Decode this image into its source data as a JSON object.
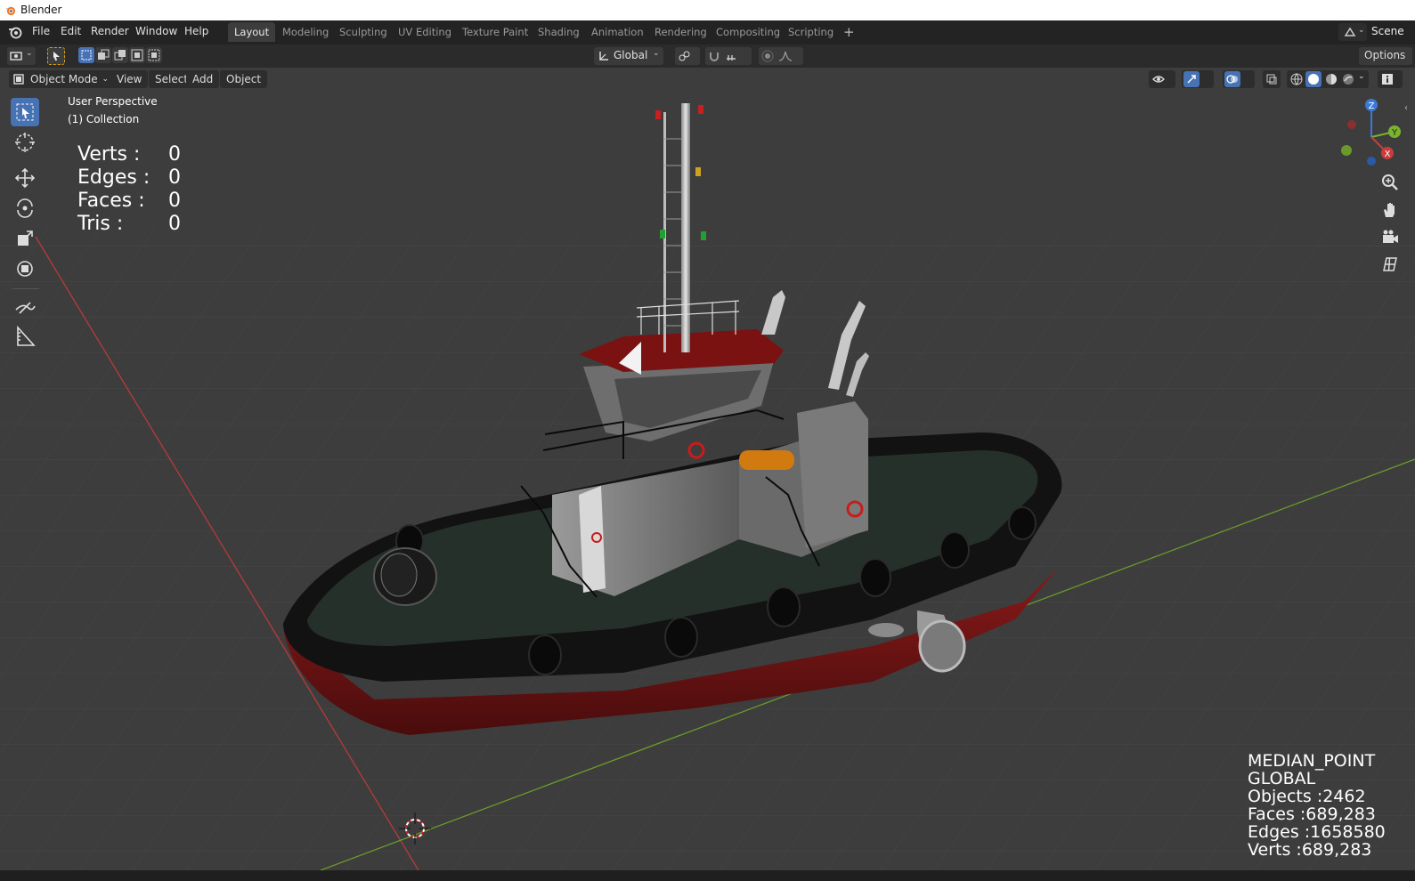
{
  "window": {
    "title": "Blender"
  },
  "menu": [
    "File",
    "Edit",
    "Render",
    "Window",
    "Help"
  ],
  "workspaces": [
    "Layout",
    "Modeling",
    "Sculpting",
    "UV Editing",
    "Texture Paint",
    "Shading",
    "Animation",
    "Rendering",
    "Compositing",
    "Scripting"
  ],
  "workspace_active": "Layout",
  "add_workspace": "+",
  "scene_label": "Scene",
  "toolheader": {
    "transform_orientation": "Global",
    "options_label": "Options"
  },
  "viewport_header": {
    "mode": "Object Mode",
    "menus": [
      "View",
      "Select",
      "Add",
      "Object"
    ]
  },
  "viewport_info": {
    "perspective": "User Perspective",
    "collection": "(1) Collection"
  },
  "selection_stats": {
    "rows": [
      {
        "label": "Verts :",
        "value": "0"
      },
      {
        "label": "Edges :",
        "value": "0"
      },
      {
        "label": "Faces :",
        "value": "0"
      },
      {
        "label": "Tris :",
        "value": "0"
      }
    ]
  },
  "scene_stats": {
    "pivot": "MEDIAN_POINT",
    "orientation": "GLOBAL",
    "objects": "Objects :2462",
    "faces": "Faces :689,283",
    "edges": "Edges :1658580",
    "verts": "Verts :689,283"
  },
  "gizmo": {
    "z": "Z",
    "y": "Y",
    "x": "X"
  },
  "colors": {
    "accent": "#4772b3",
    "x_axis": "#c83c3c",
    "y_axis": "#7ab32e",
    "z_axis": "#3a7ad6",
    "hull_red": "#7a1616",
    "deck_green": "#26302b"
  }
}
